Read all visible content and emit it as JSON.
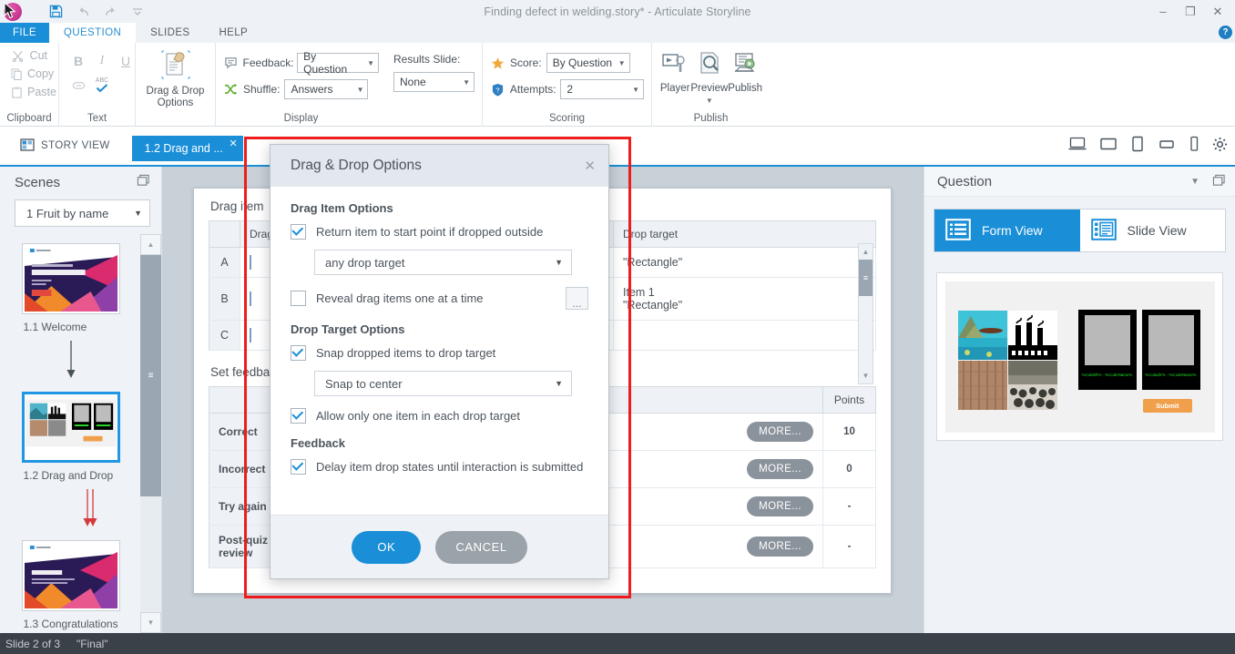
{
  "window": {
    "title": "Finding defect in welding.story* - Articulate Storyline",
    "minimize_label": "–",
    "maximize_label": "❐",
    "close_label": "✕"
  },
  "quick_access": {
    "save_icon": "save-icon",
    "undo_icon": "undo-icon",
    "redo_icon": "redo-icon",
    "customize_icon": "chevron-down-icon"
  },
  "ribbon_tabs": [
    {
      "label": "FILE",
      "state": "file"
    },
    {
      "label": "QUESTION",
      "state": "active"
    },
    {
      "label": "SLIDES",
      "state": "normal"
    },
    {
      "label": "HELP",
      "state": "normal"
    }
  ],
  "help_badge": "?",
  "ribbon": {
    "clipboard": {
      "group_label": "Clipboard",
      "items": [
        {
          "label": "Cut",
          "icon": "scissors-icon"
        },
        {
          "label": "Copy",
          "icon": "copy-icon"
        },
        {
          "label": "Paste",
          "icon": "paste-icon"
        }
      ]
    },
    "text": {
      "group_label": "Text",
      "bold": "B",
      "italic": "I",
      "underline": "U",
      "link_icon": "link-icon",
      "spelling_icon": "spelling-abc-icon",
      "spelling_label": "ABC"
    },
    "drag_drop": {
      "button_line1": "Drag & Drop",
      "button_line2": "Options",
      "icon": "drag-drop-options-icon"
    },
    "display": {
      "group_label": "Display",
      "feedback_label": "Feedback:",
      "feedback_value": "By Question",
      "feedback_icon": "feedback-bubble-icon",
      "shuffle_label": "Shuffle:",
      "shuffle_value": "Answers",
      "shuffle_icon": "shuffle-icon",
      "results_slide_label": "Results Slide:",
      "results_slide_value": "None"
    },
    "scoring": {
      "group_label": "Scoring",
      "score_label": "Score:",
      "score_value": "By Question",
      "score_icon": "star-icon",
      "attempts_label": "Attempts:",
      "attempts_value": "2",
      "attempts_icon": "shield-question-icon"
    },
    "publish": {
      "group_label": "Publish",
      "buttons": [
        {
          "label": "Player",
          "icon": "player-icon"
        },
        {
          "label": "Preview",
          "icon": "preview-icon",
          "has_dropdown": true
        },
        {
          "label": "Publish",
          "icon": "publish-icon"
        }
      ]
    }
  },
  "tabstrip": {
    "story_view_label": "STORY VIEW",
    "story_view_icon": "story-view-icon",
    "slide_tab_label": "1.2 Drag and ...",
    "slide_tab_close": "✕",
    "devices": [
      {
        "name": "desktop-icon"
      },
      {
        "name": "monitor-icon"
      },
      {
        "name": "tablet-portrait-icon"
      },
      {
        "name": "tablet-landscape-icon"
      },
      {
        "name": "phone-icon"
      },
      {
        "name": "gear-icon"
      }
    ]
  },
  "scenes_panel": {
    "header": "Scenes",
    "header_icon": "restore-panel-icon",
    "scene_select_value": "1 Fruit by name",
    "slides": [
      {
        "label": "1.1 Welcome",
        "selected": false,
        "kind": "title"
      },
      {
        "label": "1.2 Drag and Drop",
        "selected": true,
        "kind": "dragdrop"
      },
      {
        "label": "1.3 Congratulations",
        "selected": false,
        "kind": "congrats"
      }
    ],
    "scroll_up": "▲",
    "scroll_down": "▼",
    "grip": "≡"
  },
  "form_view": {
    "drag_items_title": "Drag item",
    "drag_items_headers": [
      "",
      "Drag",
      "Drop target"
    ],
    "drag_items_rows": [
      {
        "index": "A",
        "drag": "rect",
        "target": "\"Rectangle\""
      },
      {
        "index": "B",
        "drag": "rect",
        "target": "Item 1\n\"Rectangle\""
      },
      {
        "index": "C",
        "drag": "rect",
        "target": ""
      }
    ],
    "feedback_title": "Set feedback",
    "feedback_headers": [
      "",
      "",
      "Points"
    ],
    "feedback_rows": [
      {
        "label": "Correct",
        "more": "MORE...",
        "points": "10"
      },
      {
        "label": "Incorrect",
        "more": "MORE...",
        "points": "0"
      },
      {
        "label": "Try again",
        "more": "MORE...",
        "points": "-"
      },
      {
        "label": "Post-quiz review",
        "more": "MORE...",
        "points": "-"
      }
    ],
    "scroll_up": "▲",
    "scroll_down": "▼",
    "grip": "≡"
  },
  "question_panel": {
    "header": "Question",
    "header_caret": "▼",
    "header_restore_icon": "restore-panel-icon",
    "tabs": [
      {
        "label": "Form View",
        "icon": "form-view-icon",
        "active": true
      },
      {
        "label": "Slide View",
        "icon": "slide-view-icon",
        "active": false
      }
    ],
    "preview": {
      "submit_label": "Submit",
      "target_captions": [
        "%ColdefI% - %CodeName%",
        "%ColadX% - %CodeName%"
      ]
    }
  },
  "dialog": {
    "title": "Drag & Drop Options",
    "close_label": "✕",
    "sections": [
      {
        "heading": "Drag Item Options",
        "items": [
          {
            "type": "checkbox",
            "label": "Return item to start point if dropped outside",
            "checked": true
          },
          {
            "type": "select",
            "value": "any drop target",
            "caret": "▼"
          },
          {
            "type": "checkbox_with_button",
            "label": "Reveal drag items one at a time",
            "checked": false,
            "button_label": "..."
          }
        ]
      },
      {
        "heading": "Drop Target Options",
        "items": [
          {
            "type": "checkbox",
            "label": "Snap dropped items to drop target",
            "checked": true
          },
          {
            "type": "select",
            "value": "Snap to center",
            "caret": "▼"
          },
          {
            "type": "checkbox",
            "label": "Allow only one item in each drop target",
            "checked": true
          }
        ]
      },
      {
        "heading": "Feedback",
        "items": [
          {
            "type": "checkbox",
            "label": "Delay item drop states until interaction is submitted",
            "checked": true
          }
        ]
      }
    ],
    "ok_label": "OK",
    "cancel_label": "CANCEL"
  },
  "statusbar": {
    "slide_counter": "Slide 2 of 3",
    "state_name": "\"Final\""
  },
  "colors": {
    "accent": "#1a8fd8",
    "annotation": "#ee1c1c",
    "panel_bg": "#eff3f7",
    "workspace_bg": "#c8d0d8",
    "status_bg": "#3b4148"
  }
}
